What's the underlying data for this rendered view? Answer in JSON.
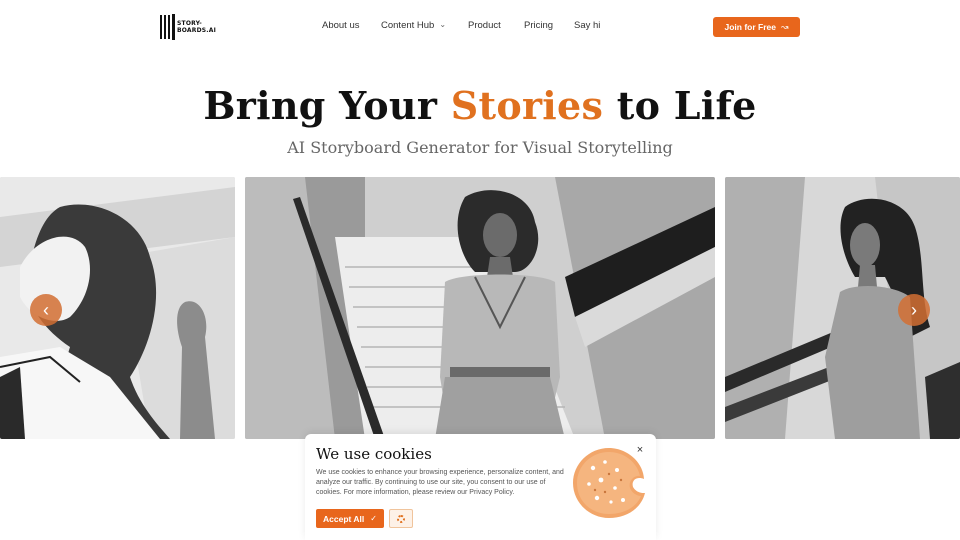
{
  "brand": {
    "logo_text": "STORY-\nBOARDS.AI",
    "accent_color": "#e8661c"
  },
  "nav": {
    "items": [
      {
        "label": "About us"
      },
      {
        "label": "Content Hub",
        "has_dropdown": true
      },
      {
        "label": "Product"
      },
      {
        "label": "Pricing"
      },
      {
        "label": "Say hi"
      }
    ],
    "cta_label": "Join for Free"
  },
  "hero": {
    "title_pre": "Bring Your",
    "title_accent": "Stories",
    "title_post": "to Life",
    "subtitle": "AI Storyboard Generator for Visual Storytelling"
  },
  "carousel": {
    "slides": [
      {
        "icon": "sketch-image"
      },
      {
        "icon": "sketch-image"
      },
      {
        "icon": "sketch-image"
      }
    ],
    "prev_icon": "chevron-left-icon",
    "next_icon": "chevron-right-icon"
  },
  "cookie": {
    "title": "We use cookies",
    "text": "We use cookies to enhance your browsing experience, personalize content, and analyze our traffic. By continuing to use our site, you consent to our use of cookies. For more information, please review our Privacy Policy.",
    "accept_label": "Accept All",
    "close_label": "×"
  }
}
